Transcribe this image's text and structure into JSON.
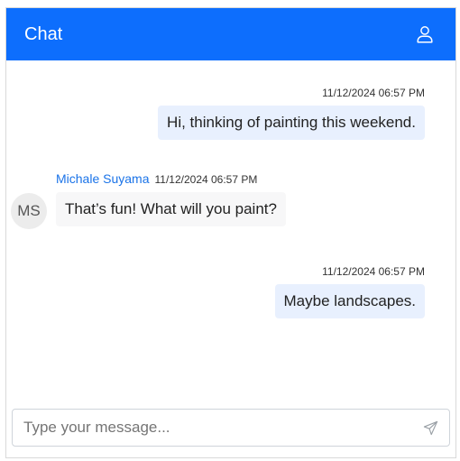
{
  "header": {
    "title": "Chat",
    "user_icon": "user-icon",
    "background_color": "#0d6efd"
  },
  "messages": [
    {
      "direction": "outgoing",
      "timestamp": "11/12/2024 06:57 PM",
      "text": "Hi, thinking of painting this weekend."
    },
    {
      "direction": "incoming",
      "sender": "Michale Suyama",
      "avatar_initials": "MS",
      "timestamp": "11/12/2024 06:57 PM",
      "text": "That’s fun! What will you paint?"
    },
    {
      "direction": "outgoing",
      "timestamp": "11/12/2024 06:57 PM",
      "text": "Maybe landscapes."
    }
  ],
  "composer": {
    "placeholder": "Type your message...",
    "value": "",
    "send_icon": "send-icon"
  }
}
